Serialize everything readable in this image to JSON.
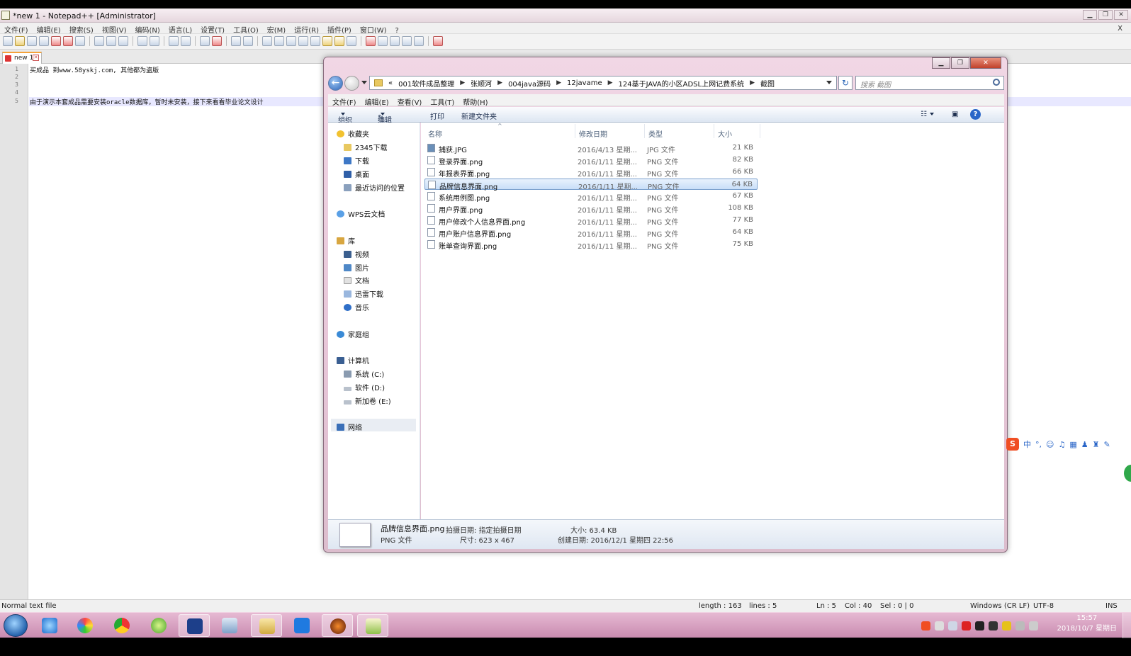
{
  "notepad": {
    "title": "*new 1 - Notepad++ [Administrator]",
    "menu": [
      "文件(F)",
      "编辑(E)",
      "搜索(S)",
      "视图(V)",
      "编码(N)",
      "语言(L)",
      "设置(T)",
      "工具(O)",
      "宏(M)",
      "运行(R)",
      "插件(P)",
      "窗口(W)",
      "?"
    ],
    "menu_close": "X",
    "tab_label": "new 1",
    "line_numbers": [
      "1",
      "2",
      "3",
      "4",
      "5"
    ],
    "lines": [
      "买成品    到www.58yskj.com, 其他都为盗版",
      "",
      "",
      "",
      "由于演示本套成品需要安装oracle数据库，暂时未安装，接下来看看毕业论文设计"
    ],
    "status": {
      "type": "Normal text file",
      "length": "length : 163",
      "lines": "lines : 5",
      "ln": "Ln : 5",
      "col": "Col : 40",
      "sel": "Sel : 0 | 0",
      "eol": "Windows (CR LF)",
      "encoding": "UTF-8",
      "mode": "INS"
    }
  },
  "explorer": {
    "breadcrumb_prefix": "«",
    "breadcrumb": [
      "001软件成品整理",
      "张顺河",
      "004java源码",
      "12javame",
      "124基于JAVA的小区ADSL上网记费系统",
      "截图"
    ],
    "search_placeholder": "搜索 截图",
    "menu": [
      "文件(F)",
      "编辑(E)",
      "查看(V)",
      "工具(T)",
      "帮助(H)"
    ],
    "toolbar": {
      "organize": "组织",
      "edit": "编辑",
      "print": "打印",
      "new_folder": "新建文件夹"
    },
    "nav": {
      "favorites": "收藏夹",
      "fav_items": [
        "2345下载",
        "下载",
        "桌面",
        "最近访问的位置"
      ],
      "wps": "WPS云文档",
      "library": "库",
      "lib_items": [
        "视频",
        "图片",
        "文档",
        "迅雷下载",
        "音乐"
      ],
      "homegroup": "家庭组",
      "computer": "计算机",
      "drives": [
        "系统 (C:)",
        "软件 (D:)",
        "新加卷 (E:)"
      ],
      "network": "网络"
    },
    "columns": {
      "name": "名称",
      "date": "修改日期",
      "type": "类型",
      "size": "大小"
    },
    "files": [
      {
        "name": "捕获.JPG",
        "date": "2016/4/13 星期...",
        "type": "JPG 文件",
        "size": "21 KB"
      },
      {
        "name": "登录界面.png",
        "date": "2016/1/11 星期...",
        "type": "PNG 文件",
        "size": "82 KB"
      },
      {
        "name": "年报表界面.png",
        "date": "2016/1/11 星期...",
        "type": "PNG 文件",
        "size": "66 KB"
      },
      {
        "name": "品牌信息界面.png",
        "date": "2016/1/11 星期...",
        "type": "PNG 文件",
        "size": "64 KB"
      },
      {
        "name": "系统用例图.png",
        "date": "2016/1/11 星期...",
        "type": "PNG 文件",
        "size": "67 KB"
      },
      {
        "name": "用户界面.png",
        "date": "2016/1/11 星期...",
        "type": "PNG 文件",
        "size": "108 KB"
      },
      {
        "name": "用户修改个人信息界面.png",
        "date": "2016/1/11 星期...",
        "type": "PNG 文件",
        "size": "77 KB"
      },
      {
        "name": "用户账户信息界面.png",
        "date": "2016/1/11 星期...",
        "type": "PNG 文件",
        "size": "64 KB"
      },
      {
        "name": "账单查询界面.png",
        "date": "2016/1/11 星期...",
        "type": "PNG 文件",
        "size": "75 KB"
      }
    ],
    "details": {
      "filename": "品牌信息界面.png",
      "filetype": "PNG 文件",
      "shot_date": "拍摄日期: 指定拍摄日期",
      "dimensions": "尺寸: 623 x 467",
      "size": "大小: 63.4 KB",
      "created": "创建日期: 2016/12/1 星期四 22:56"
    }
  },
  "ime": {
    "lang": "中",
    "punct": "°,"
  },
  "taskbar": {
    "time": "15:57",
    "date": "2018/10/7 星期日"
  }
}
